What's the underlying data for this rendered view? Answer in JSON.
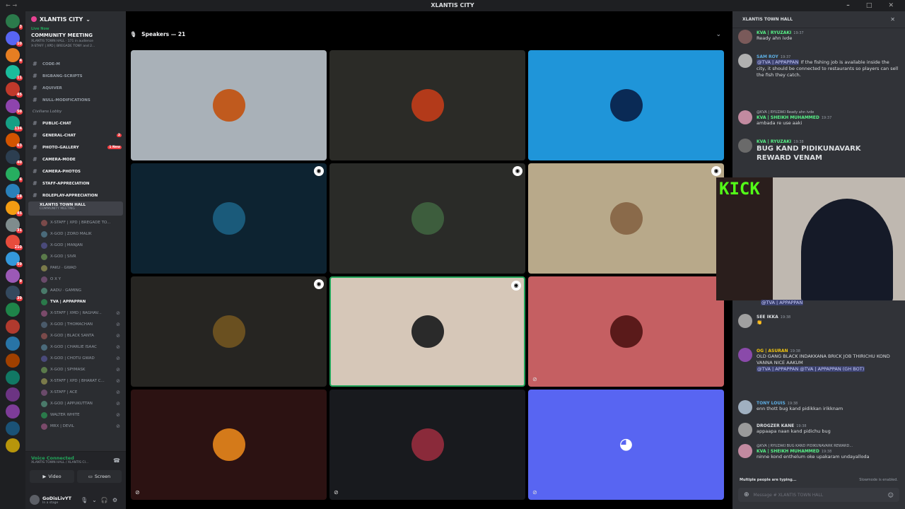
{
  "window": {
    "title": "XLANTIS CITY"
  },
  "rail": {
    "badges": [
      "3",
      "10",
      "4",
      "11",
      "45",
      "50",
      "134",
      "63",
      "40",
      "6",
      "18",
      "45",
      "31",
      "210",
      "59",
      "9",
      "39"
    ]
  },
  "sidebar": {
    "server_name": "XLANTIS CITY",
    "live_label": "Live Now",
    "event_title": "COMMUNITY MEETING",
    "event_sub": "XLANTIS TOWN HALL · 171 in audience",
    "event_sub2": "X-STAFF | XPD | BREGADE TONY and 2...",
    "channels_top": [
      {
        "name": "CODE-M"
      },
      {
        "name": "BIGBANG-SCRIPTS"
      },
      {
        "name": "AQUIVER"
      },
      {
        "name": "NULL-MODIFICATIONS"
      }
    ],
    "category": "Civilians Lobby",
    "channels": [
      {
        "name": "PUBLIC-CHAT",
        "badge": ""
      },
      {
        "name": "GENERAL-CHAT",
        "badge": "2"
      },
      {
        "name": "PHOTO-GALLERY",
        "badge": "1 New"
      },
      {
        "name": "CAMERA-MODE",
        "badge": ""
      },
      {
        "name": "CAMERA-PHOTOS",
        "badge": ""
      },
      {
        "name": "STAFF-APPRECIATION",
        "badge": ""
      },
      {
        "name": "ROLEPLAY-APPRECIATION",
        "badge": ""
      }
    ],
    "active_voice": {
      "name": "XLANTIS TOWN HALL",
      "sub": "COMMUNITY MEETING"
    },
    "voice_users": [
      "X-STAFF | XPD | BREGADE TO...",
      "X-GOD | ZORO MALIK",
      "X-GOD | MANJAN",
      "X-GOD | SIVR",
      "PAKU · GWAD",
      "O X Y",
      "AADU · GAMING",
      "TVA | APPAPPAN",
      "X-STAFF | XMD | RAGHAV...",
      "X-GOD | THOMACHAN",
      "X-GOD | BLACK SANTA",
      "X-GOD | CHARLIE ISAAC",
      "X-GOD | CHOTU GWAD",
      "X-GOD | SPYMASK",
      "X-STAFF | XPD | BHARAT C...",
      "X-STAFF | ACE",
      "X-GOD | APPUKUTTAN",
      "WALTER WHITE",
      "MRX | DEVIL"
    ],
    "voice_status": "Voice Connected",
    "voice_channel": "XLANTIS TOWN HALL / XLANTIS CI...",
    "video_label": "Video",
    "screen_label": "Screen",
    "username": "GoDisLivYT",
    "user_status": "In a stage"
  },
  "stage": {
    "speakers_label": "Speakers — 21",
    "tiles": [
      {
        "bg": "#a9b1b8",
        "pic": "#c05a1e",
        "speaker": false,
        "mic": false
      },
      {
        "bg": "#2b2b27",
        "pic": "#b33a1a",
        "speaker": false,
        "mic": false
      },
      {
        "bg": "#1f95d9",
        "pic": "#0a2a55",
        "speaker": false,
        "mic": false
      },
      {
        "bg": "#0d2331",
        "pic": "#1a5a7a",
        "speaker": true,
        "mic": false
      },
      {
        "bg": "#2a2b28",
        "pic": "#3d5d3d",
        "speaker": true,
        "mic": false
      },
      {
        "bg": "#b8a98a",
        "pic": "#8a6a4a",
        "speaker": true,
        "mic": false
      },
      {
        "bg": "#262522",
        "pic": "#6a5020",
        "speaker": true,
        "mic": false
      },
      {
        "bg": "#d6c7b8",
        "pic": "#2a2a2a",
        "speaker": true,
        "mic": false
      },
      {
        "bg": "#c55f62",
        "pic": "#5a1a1a",
        "speaker": false,
        "mic": true
      },
      {
        "bg": "#2c1212",
        "pic": "#d47a1a",
        "speaker": false,
        "mic": true
      },
      {
        "bg": "#181a1e",
        "pic": "#8a2a3a",
        "speaker": false,
        "mic": true
      },
      {
        "bg": "#5865f2",
        "pic": "#5865f2",
        "speaker": false,
        "mic": true
      }
    ]
  },
  "chat": {
    "channel": "XLANTIS TOWN HALL",
    "messages": [
      {
        "name": "KVA | RYUZAKI",
        "color": "#57f287",
        "time": "19:37",
        "text": "Ready ahn ivde"
      },
      {
        "name": "SAM ROY",
        "color": "#5dade2",
        "time": "19:37",
        "mention": "@TVA | APPAPPAN",
        "text": "If the fishing job is available inside the city, it should be connected to restaurants so players can sell the fish they catch."
      },
      {
        "name": "KVA | SHEIKH MUHAMMED",
        "color": "#57f287",
        "time": "19:37",
        "reply": "@KVA | RYUZAKI Ready ahn ivde",
        "text": "ambada re use aaki"
      },
      {
        "name": "KVA | RYUZAKI",
        "color": "#57f287",
        "time": "19:38",
        "text": "BUG KAND PIDIKUNAVARK REWARD VENAM"
      },
      {
        "name": "SEE IKKA",
        "color": "#dbdee1",
        "time": "19:38",
        "text": "👏"
      },
      {
        "name": "OG | ASURAN",
        "color": "#f1c40f",
        "time": "19:38",
        "text": "OLD GANG BLACK INDAKKANA BRICK JOB THIRICHU KOND VANNA NICE AAKUM",
        "mention": "@TVA | APPAPPAN @TVA | APPAPPAN (GH BOT)"
      },
      {
        "name": "TONY LOUIS",
        "color": "#5dade2",
        "time": "19:38",
        "text": "enn thott bug kand pidikkan irikknam"
      },
      {
        "name": "DROGZER KANE",
        "color": "#dbdee1",
        "time": "19:38",
        "text": "appaapa naan kand pidichu bug"
      },
      {
        "name": "KVA | SHEIKH MUHAMMED",
        "color": "#57f287",
        "time": "19:38",
        "reply": "@KVA | RYUZAKI BUG KAND PIDIKUNAVARK REWARD...",
        "text": "ninne kond enthelum oke upakaram undayalloda"
      }
    ],
    "mention_top": "@TVA | APPAPPAN",
    "typing": "Multiple people are typing...",
    "slowmode": "Slowmode is enabled.",
    "input_placeholder": "Message # XLANTIS TOWN HALL",
    "webcam_label": "KICK"
  }
}
